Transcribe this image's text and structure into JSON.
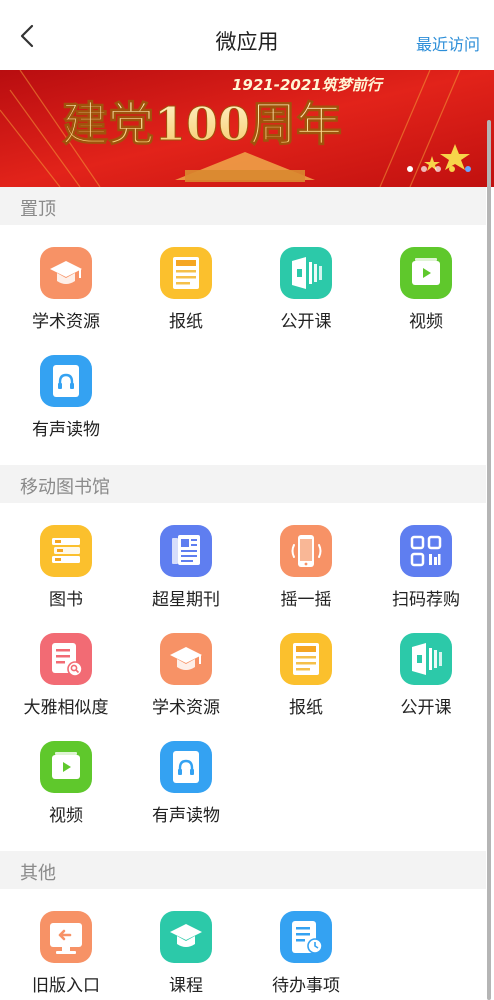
{
  "header": {
    "title": "微应用",
    "recent_label": "最近访问"
  },
  "banner": {
    "years": "1921-2021筑梦前行",
    "main_text": "建党100周年"
  },
  "sections": [
    {
      "title": "置顶",
      "apps": [
        {
          "label": "学术资源",
          "icon": "graduation-cap-icon",
          "color": "#f79266"
        },
        {
          "label": "报纸",
          "icon": "newspaper-icon",
          "color": "#fbc02d"
        },
        {
          "label": "公开课",
          "icon": "open-course-icon",
          "color": "#2cc9a9"
        },
        {
          "label": "视频",
          "icon": "video-play-icon",
          "color": "#5fc82c"
        },
        {
          "label": "有声读物",
          "icon": "headphones-book-icon",
          "color": "#34a2f2"
        }
      ]
    },
    {
      "title": "移动图书馆",
      "apps": [
        {
          "label": "图书",
          "icon": "books-stack-icon",
          "color": "#fbc02d"
        },
        {
          "label": "超星期刊",
          "icon": "journal-icon",
          "color": "#5f7ef0"
        },
        {
          "label": "摇一摇",
          "icon": "shake-phone-icon",
          "color": "#f79266"
        },
        {
          "label": "扫码荐购",
          "icon": "qr-code-icon",
          "color": "#5f7ef0"
        },
        {
          "label": "大雅相似度",
          "icon": "document-search-icon",
          "color": "#f26b74"
        },
        {
          "label": "学术资源",
          "icon": "graduation-cap-icon",
          "color": "#f79266"
        },
        {
          "label": "报纸",
          "icon": "newspaper-icon",
          "color": "#fbc02d"
        },
        {
          "label": "公开课",
          "icon": "open-course-icon",
          "color": "#2cc9a9"
        },
        {
          "label": "视频",
          "icon": "video-play-icon",
          "color": "#5fc82c"
        },
        {
          "label": "有声读物",
          "icon": "headphones-book-icon",
          "color": "#34a2f2"
        }
      ]
    },
    {
      "title": "其他",
      "apps": [
        {
          "label": "旧版入口",
          "icon": "old-version-entry-icon",
          "color": "#f79266"
        },
        {
          "label": "课程",
          "icon": "course-cap-icon",
          "color": "#2cc9a9"
        },
        {
          "label": "待办事项",
          "icon": "todo-list-icon",
          "color": "#34a2f2"
        }
      ]
    }
  ]
}
